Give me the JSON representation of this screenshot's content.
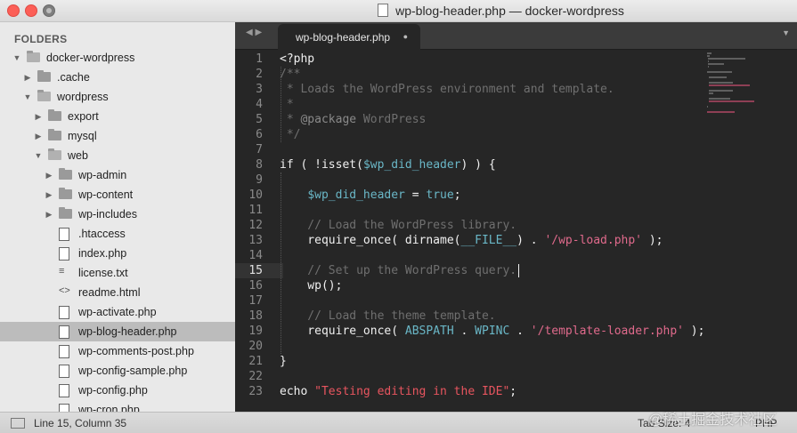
{
  "window": {
    "title": "wp-blog-header.php — docker-wordpress"
  },
  "sidebar": {
    "heading": "FOLDERS",
    "tree": [
      {
        "label": "docker-wordpress",
        "type": "folder",
        "open": true,
        "depth": 0
      },
      {
        "label": ".cache",
        "type": "folder",
        "open": false,
        "depth": 1
      },
      {
        "label": "wordpress",
        "type": "folder",
        "open": true,
        "depth": 1
      },
      {
        "label": "export",
        "type": "folder",
        "open": false,
        "depth": 2
      },
      {
        "label": "mysql",
        "type": "folder",
        "open": false,
        "depth": 2
      },
      {
        "label": "web",
        "type": "folder",
        "open": true,
        "depth": 2
      },
      {
        "label": "wp-admin",
        "type": "folder",
        "open": false,
        "depth": 3
      },
      {
        "label": "wp-content",
        "type": "folder",
        "open": false,
        "depth": 3
      },
      {
        "label": "wp-includes",
        "type": "folder",
        "open": false,
        "depth": 3
      },
      {
        "label": ".htaccess",
        "type": "file",
        "depth": 3
      },
      {
        "label": "index.php",
        "type": "file",
        "depth": 3
      },
      {
        "label": "license.txt",
        "type": "text",
        "depth": 3
      },
      {
        "label": "readme.html",
        "type": "code",
        "depth": 3
      },
      {
        "label": "wp-activate.php",
        "type": "file",
        "depth": 3
      },
      {
        "label": "wp-blog-header.php",
        "type": "file",
        "depth": 3,
        "selected": true
      },
      {
        "label": "wp-comments-post.php",
        "type": "file",
        "depth": 3
      },
      {
        "label": "wp-config-sample.php",
        "type": "file",
        "depth": 3
      },
      {
        "label": "wp-config.php",
        "type": "file",
        "depth": 3
      },
      {
        "label": "wp-cron.php",
        "type": "file",
        "depth": 3
      }
    ]
  },
  "editor": {
    "tab_label": "wp-blog-header.php",
    "current_line": 15,
    "lines": [
      {
        "n": "1",
        "segs": [
          [
            "<?php",
            "kw"
          ]
        ]
      },
      {
        "n": "2",
        "segs": [
          [
            "/**",
            "cmt"
          ]
        ]
      },
      {
        "n": "3",
        "segs": [
          [
            " * Loads the WordPress environment and template.",
            "cmt"
          ]
        ]
      },
      {
        "n": "4",
        "segs": [
          [
            " *",
            "cmt"
          ]
        ]
      },
      {
        "n": "5",
        "segs": [
          [
            " * ",
            "cmt"
          ],
          [
            "@package",
            "doc"
          ],
          [
            " WordPress",
            "cmt"
          ]
        ]
      },
      {
        "n": "6",
        "segs": [
          [
            " */",
            "cmt"
          ]
        ]
      },
      {
        "n": "7",
        "segs": []
      },
      {
        "n": "8",
        "segs": [
          [
            "if ( !",
            "kw"
          ],
          [
            "isset",
            "fn"
          ],
          [
            "(",
            "kw"
          ],
          [
            "$wp_did_header",
            "var"
          ],
          [
            ") ) {",
            "kw"
          ]
        ]
      },
      {
        "n": "9",
        "segs": []
      },
      {
        "n": "10",
        "segs": [
          [
            "    ",
            "kw"
          ],
          [
            "$wp_did_header",
            "var"
          ],
          [
            " = ",
            "kw"
          ],
          [
            "true",
            "bool"
          ],
          [
            ";",
            "kw"
          ]
        ]
      },
      {
        "n": "11",
        "segs": []
      },
      {
        "n": "12",
        "segs": [
          [
            "    // Load the WordPress library.",
            "cmt"
          ]
        ]
      },
      {
        "n": "13",
        "segs": [
          [
            "    require_once( dirname(",
            "kw"
          ],
          [
            "__FILE__",
            "const"
          ],
          [
            ") . ",
            "kw"
          ],
          [
            "'/wp-load.php'",
            "str"
          ],
          [
            " );",
            "kw"
          ]
        ]
      },
      {
        "n": "14",
        "segs": []
      },
      {
        "n": "15",
        "segs": [
          [
            "    // Set up the WordPress query.",
            "cmt"
          ]
        ]
      },
      {
        "n": "16",
        "segs": [
          [
            "    wp();",
            "kw"
          ]
        ]
      },
      {
        "n": "17",
        "segs": []
      },
      {
        "n": "18",
        "segs": [
          [
            "    // Load the theme template.",
            "cmt"
          ]
        ]
      },
      {
        "n": "19",
        "segs": [
          [
            "    require_once( ",
            "kw"
          ],
          [
            "ABSPATH",
            "const"
          ],
          [
            " . ",
            "kw"
          ],
          [
            "WPINC",
            "const"
          ],
          [
            " . ",
            "kw"
          ],
          [
            "'/template-loader.php'",
            "str"
          ],
          [
            " );",
            "kw"
          ]
        ]
      },
      {
        "n": "20",
        "segs": []
      },
      {
        "n": "21",
        "segs": [
          [
            "}",
            "kw"
          ]
        ]
      },
      {
        "n": "22",
        "segs": []
      },
      {
        "n": "23",
        "segs": [
          [
            "echo ",
            "kw"
          ],
          [
            "\"Testing editing in the IDE\"",
            "str2"
          ],
          [
            ";",
            "kw"
          ]
        ]
      }
    ]
  },
  "status": {
    "position": "Line 15, Column 35",
    "tab_size": "Tab Size: 4",
    "syntax": "PHP"
  },
  "watermark": "@稀土掘金技术社区",
  "colors": {
    "comment": "#6f6f6f",
    "variable": "#6ab7c7",
    "string": "#e06a8c",
    "selection": "#bcbcbc"
  }
}
